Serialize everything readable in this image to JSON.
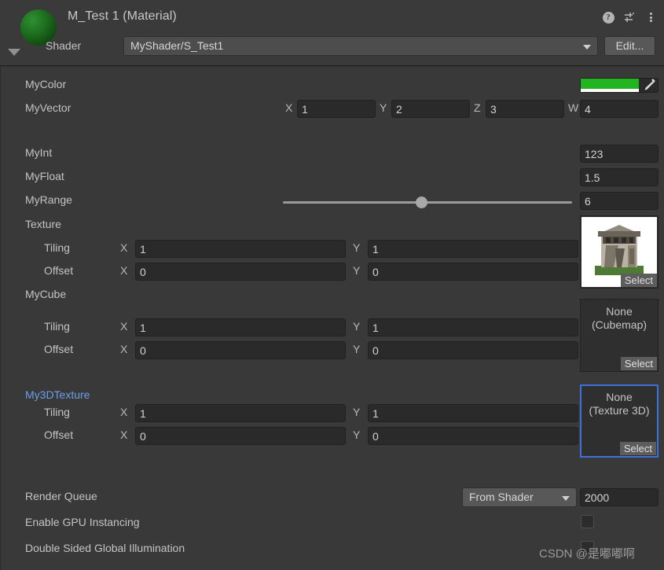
{
  "header": {
    "title": "M_Test 1 (Material)",
    "shader_label": "Shader",
    "shader_value": "MyShader/S_Test1",
    "edit_label": "Edit...",
    "help_glyph": "?",
    "sphere_color": "#1f7020"
  },
  "properties": {
    "mycolor": {
      "label": "MyColor",
      "color": "#22b522"
    },
    "myvector": {
      "label": "MyVector",
      "axes": [
        "X",
        "Y",
        "Z",
        "W"
      ],
      "values": [
        "1",
        "2",
        "3",
        "4"
      ]
    },
    "myint": {
      "label": "MyInt",
      "value": "123"
    },
    "myfloat": {
      "label": "MyFloat",
      "value": "1.5"
    },
    "myrange": {
      "label": "MyRange",
      "value": "6",
      "slider_percent": 48
    }
  },
  "textures": [
    {
      "label": "Texture",
      "label_color": "#c4c4c4",
      "none_text": "",
      "type_text": "",
      "select_label": "Select",
      "has_thumbnail": true,
      "selected": false,
      "tiling_label": "Tiling",
      "offset_label": "Offset",
      "x_letter": "X",
      "y_letter": "Y",
      "tiling_x": "1",
      "tiling_y": "1",
      "offset_x": "0",
      "offset_y": "0"
    },
    {
      "label": "MyCube",
      "label_color": "#c4c4c4",
      "none_text": "None",
      "type_text": "(Cubemap)",
      "select_label": "Select",
      "has_thumbnail": false,
      "selected": false,
      "tiling_label": "Tiling",
      "offset_label": "Offset",
      "x_letter": "X",
      "y_letter": "Y",
      "tiling_x": "1",
      "tiling_y": "1",
      "offset_x": "0",
      "offset_y": "0"
    },
    {
      "label": "My3DTexture",
      "label_color": "#6d9eeb",
      "none_text": "None",
      "type_text": "(Texture 3D)",
      "select_label": "Select",
      "has_thumbnail": false,
      "selected": true,
      "tiling_label": "Tiling",
      "offset_label": "Offset",
      "x_letter": "X",
      "y_letter": "Y",
      "tiling_x": "1",
      "tiling_y": "1",
      "offset_x": "0",
      "offset_y": "0"
    }
  ],
  "footer": {
    "render_queue_label": "Render Queue",
    "render_queue_mode": "From Shader",
    "render_queue_value": "2000",
    "gpu_instancing_label": "Enable GPU Instancing",
    "gpu_instancing_checked": false,
    "double_sided_label": "Double Sided Global Illumination",
    "double_sided_checked": false
  },
  "watermark": "CSDN @是嘟嘟啊"
}
